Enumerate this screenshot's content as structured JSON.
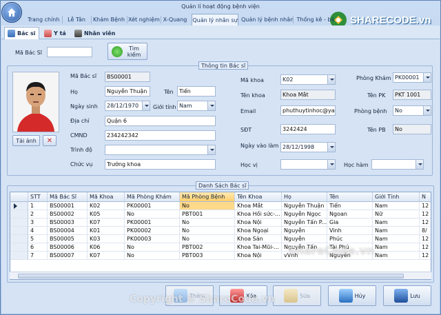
{
  "window": {
    "title": "Quản lí hoạt động bệnh viện"
  },
  "ribbon": {
    "tabs": [
      "Trang chính",
      "Lễ Tân",
      "Khám Bệnh",
      "Xét nghiệm",
      "X-Quang",
      "Quản lý nhân sự",
      "Quản lý bệnh nhân",
      "Thống kê - bá"
    ],
    "active": "Quản lý nhân sự"
  },
  "subtabs": [
    {
      "label": "Bác sĩ",
      "icon": "doctor-icon"
    },
    {
      "label": "Y tá",
      "icon": "nurse-icon"
    },
    {
      "label": "Nhân viên",
      "icon": "staff-icon"
    }
  ],
  "search": {
    "label": "Mã Bác Sĩ",
    "value": "",
    "button": "Tìm kiếm"
  },
  "info": {
    "title": "Thông tin Bác sĩ",
    "photo_button": "Tải ảnh",
    "ma_bac_si_label": "Mã Bác sĩ",
    "ma_bac_si": "BS00001",
    "ho_label": "Họ",
    "ho": "Nguyễn Thuận",
    "ten_label": "Tên",
    "ten": "Tiến",
    "ngay_sinh_label": "Ngày sinh",
    "ngay_sinh": "28/12/1970",
    "gioi_tinh_label": "Giới tính",
    "gioi_tinh": "Nam",
    "dia_chi_label": "Địa chỉ",
    "dia_chi": "Quận 6",
    "cmnd_label": "CMND",
    "cmnd": "234242342",
    "trinh_do_label": "Trình độ",
    "trinh_do": "",
    "chuc_vu_label": "Chức vụ",
    "chuc_vu": "Trưởng khoa",
    "ma_khoa_label": "Mã khoa",
    "ma_khoa": "K02",
    "ten_khoa_label": "Tên khoa",
    "ten_khoa": "Khoa Mắt",
    "email_label": "Email",
    "email": "phuthuytinhoc@yahc",
    "sdt_label": "SĐT",
    "sdt": "3242424",
    "ngay_vao_lam_label": "Ngày vào làm",
    "ngay_vao_lam": "28/12/1998",
    "hoc_vi_label": "Học vị",
    "hoc_vi": "",
    "hoc_ham_label": "Học hàm",
    "hoc_ham": "",
    "phong_kham_label": "Phòng Khám",
    "phong_kham": "PK00001",
    "ten_pk_label": "Tên PK",
    "ten_pk": "PKT 1001",
    "phong_benh_label": "Phòng bệnh",
    "phong_benh": "No",
    "ten_pb_label": "Tên PB",
    "ten_pb": "No"
  },
  "list": {
    "title": "Danh Sách Bác sĩ",
    "columns": [
      "STT",
      "Mã Bác Sĩ",
      "Mã Khoa",
      "Mã Phòng Khám",
      "Mã Phòng Bệnh",
      "Tên Khoa",
      "Họ",
      "Tên",
      "Giới Tính",
      "N"
    ],
    "rows": [
      [
        "1",
        "BS00001",
        "K02",
        "PK00001",
        "No",
        "Khoa Mắt",
        "Nguyễn Thuận",
        "Tiến",
        "Nam",
        "12"
      ],
      [
        "2",
        "BS00002",
        "K05",
        "No",
        "PBT001",
        "Khoa Hồi sức-...",
        "Nguyễn Ngọc",
        "Ngoan",
        "Nữ",
        "12"
      ],
      [
        "3",
        "BS00003",
        "K07",
        "PK00001",
        "No",
        "Khoa Nội",
        "Nguyễn Tấn P...",
        "Gia",
        "Nam",
        "12"
      ],
      [
        "4",
        "BS00004",
        "K01",
        "PK00002",
        "No",
        "Khoa Ngoại",
        "Nguyễn",
        "Vinh",
        "Nam",
        "8/"
      ],
      [
        "5",
        "BS00005",
        "K03",
        "PK00003",
        "No",
        "Khoa Sản",
        "Nguyễn",
        "Phúc",
        "Nam",
        "12"
      ],
      [
        "6",
        "BS00006",
        "K06",
        "No",
        "PBT002",
        "Khoa Tai-Mũi-...",
        "Nguyễn Tấn",
        "Tài Phú",
        "Nam",
        "12"
      ],
      [
        "7",
        "BS00007",
        "K07",
        "No",
        "PBT003",
        "Khoa Nội",
        "vVnh",
        "Nguyễn",
        "Nam",
        "12"
      ]
    ]
  },
  "actions": {
    "add": "Thêm",
    "edit": "Xóa",
    "save_disabled": "Sửa",
    "cancel": "Hủy",
    "store": "Lưu"
  },
  "watermarks": {
    "logo": "SHARECODE.vn",
    "mid": "ShareCode.vn",
    "bottom": "Copyright © ShareCode.vn"
  },
  "colors": {
    "accent": "#2a78c7",
    "highlight": "#ffd98a",
    "frame": "#a9c3e6"
  }
}
